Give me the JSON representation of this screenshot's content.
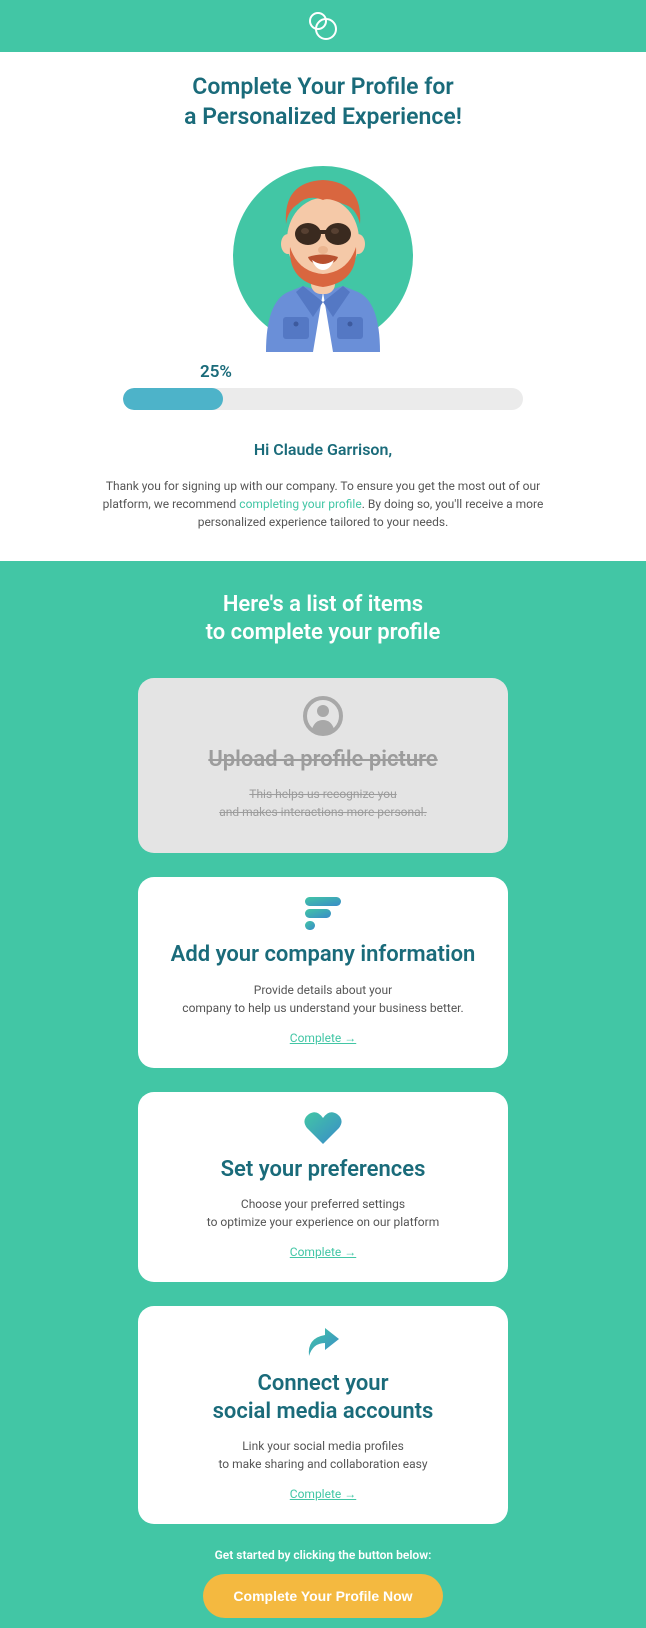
{
  "colors": {
    "teal": "#42c6a5",
    "dark_teal": "#1a6b7a",
    "progress_fill": "#4db3c9",
    "cta": "#f4b940",
    "done_bg": "#e4e4e4",
    "done_text": "#9c9c9c"
  },
  "header": {
    "title": "Complete Your Profile for\na Personalized Experience!"
  },
  "progress": {
    "label": "25%",
    "value": 25
  },
  "greeting": "Hi Claude Garrison,",
  "intro": {
    "before": "Thank you for signing up with our company. To ensure you get the most out of our platform, we recommend ",
    "link": "completing your profile",
    "after": ". By doing so, you'll receive a more personalized experience tailored to your needs."
  },
  "list_title": "Here's a list of items\nto complete your profile",
  "cards": [
    {
      "icon": "user-icon",
      "title": "Upload a profile picture",
      "desc": "This helps us recognize you\nand makes interactions more personal.",
      "done": true
    },
    {
      "icon": "bars-icon",
      "title": "Add your company information",
      "desc": "Provide details about your\ncompany to help us understand your business better.",
      "link": "Complete →",
      "done": false
    },
    {
      "icon": "heart-icon",
      "title": "Set your preferences",
      "desc": "Choose your preferred settings\nto optimize your experience on our platform",
      "link": "Complete →",
      "done": false
    },
    {
      "icon": "share-icon",
      "title": "Connect your\nsocial media accounts",
      "desc": "Link your social media profiles\nto make sharing and collaboration easy",
      "link": "Complete →",
      "done": false
    }
  ],
  "cta": {
    "text": "Get started by clicking the button below:",
    "button": "Complete Your Profile Now"
  }
}
